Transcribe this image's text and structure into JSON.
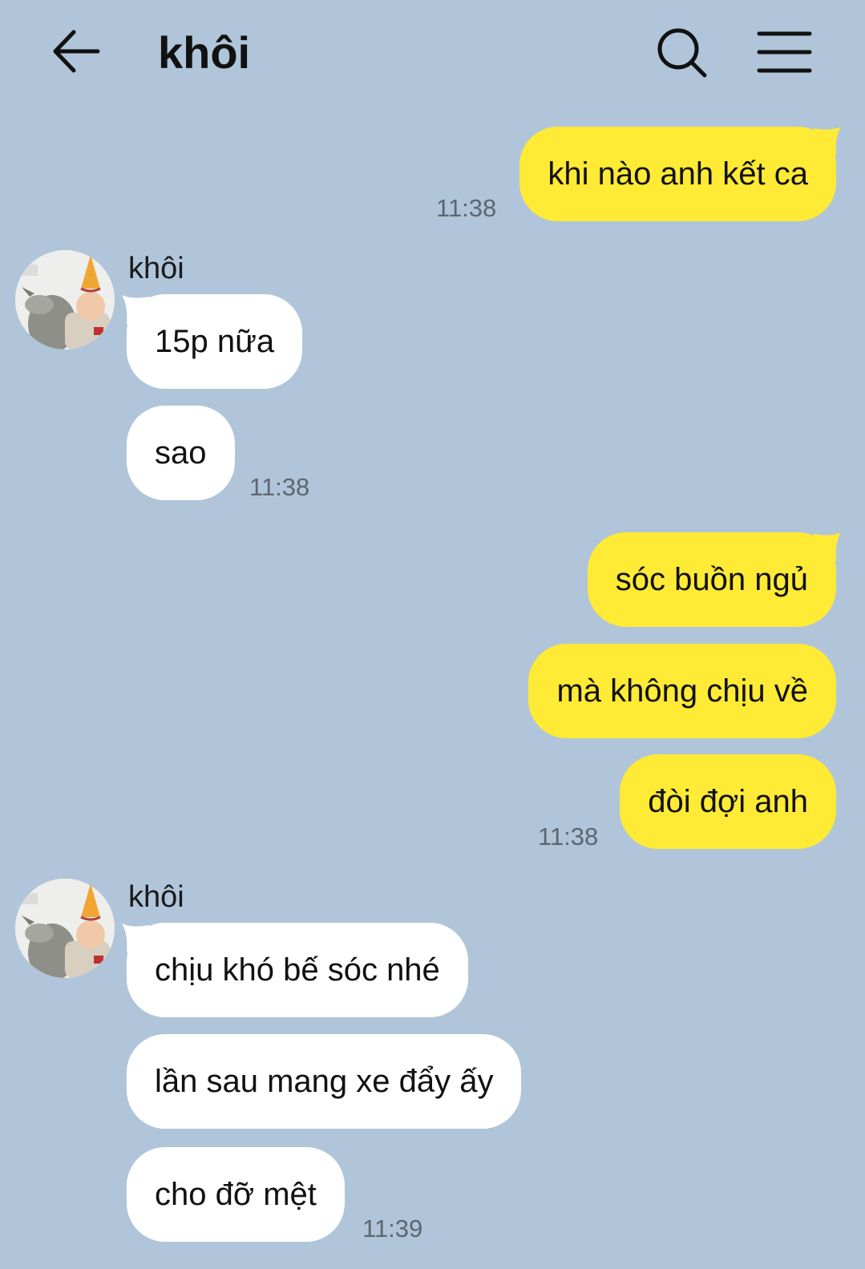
{
  "header": {
    "title": "khôi",
    "back_icon": "arrow-left-icon",
    "search_icon": "search-icon",
    "menu_icon": "hamburger-menu-icon"
  },
  "colors": {
    "background": "#b0c5d9",
    "outgoing_bubble": "#ffea35",
    "incoming_bubble": "#ffffff"
  },
  "messages": [
    {
      "direction": "out",
      "text": "khi nào anh kết ca",
      "time": "11:38"
    },
    {
      "direction": "in",
      "sender": "khôi",
      "text": "15p nữa"
    },
    {
      "direction": "in",
      "text": "sao",
      "time": "11:38"
    },
    {
      "direction": "out",
      "text": "sóc buồn ngủ"
    },
    {
      "direction": "out",
      "text": "mà không chịu về"
    },
    {
      "direction": "out",
      "text": "đòi đợi anh",
      "time": "11:38"
    },
    {
      "direction": "in",
      "sender": "khôi",
      "text": "chịu khó bế sóc nhé"
    },
    {
      "direction": "in",
      "text": "lần sau mang xe đẩy ấy"
    },
    {
      "direction": "in",
      "text": "cho đỡ mệt",
      "time": "11:39"
    }
  ]
}
